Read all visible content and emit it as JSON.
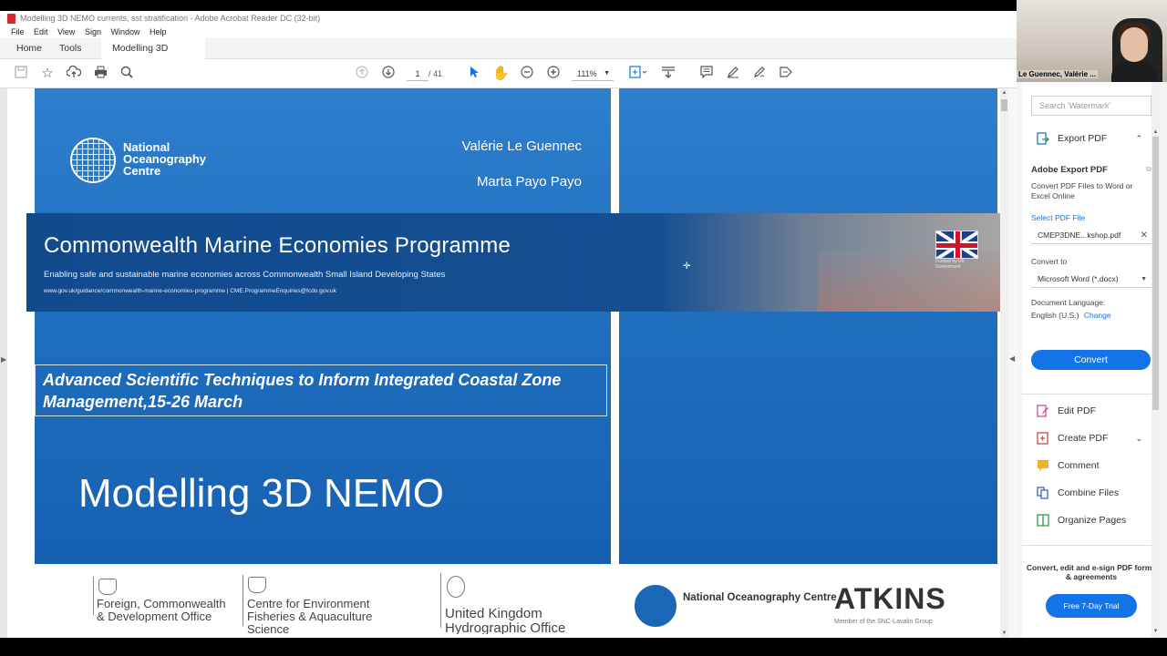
{
  "window": {
    "title": "Modelling 3D NEMO currents, sst stratification - Adobe Acrobat Reader DC (32-bit)"
  },
  "menu": [
    "File",
    "Edit",
    "View",
    "Sign",
    "Window",
    "Help"
  ],
  "tabs": {
    "home": "Home",
    "tools": "Tools",
    "doc": "Modelling 3D NEM...",
    "close": "×"
  },
  "toolbar": {
    "page_current": "1",
    "page_total": "/ 41",
    "zoom": "111%"
  },
  "slide": {
    "org": "National Oceanography Centre",
    "author1": "Valérie Le Guennec",
    "author2": "Marta Payo Payo",
    "banner_title": "Commonwealth Marine Economies Programme",
    "banner_subtitle": "Enabling safe and sustainable marine economies across Commonwealth Small Island Developing States",
    "banner_links": "www.gov.uk/guidance/commonwealth-marine-economies-programme   |   CME.ProgrammeEnquiries@fcdo.gov.uk",
    "funded": "Funded by UK Government",
    "course": "Advanced Scientific Techniques to Inform Integrated Coastal Zone Management,15-26 March",
    "title": "Modelling 3D NEMO"
  },
  "logos": {
    "fcdo": "Foreign, Commonwealth & Development Office",
    "cefas": "Centre for Environment Fisheries & Aquaculture Science",
    "ukho": "United Kingdom Hydrographic Office",
    "noc": "National Oceanography Centre",
    "atkins": "ATKINS",
    "atkins_sub": "Member of the SNC-Lavalin Group"
  },
  "right_pane": {
    "search_placeholder": "Search 'Watermark'",
    "export_pdf": "Export PDF",
    "adobe_export_heading": "Adobe Export PDF",
    "adobe_export_desc": "Convert PDF Files to Word or Excel Online",
    "select_file": "Select PDF File",
    "file_name": "CMEP3DNE...kshop.pdf",
    "convert_to_label": "Convert to",
    "convert_to_value": "Microsoft Word (*.docx)",
    "doc_language_label": "Document Language:",
    "doc_language_value": "English (U.S.)",
    "change": "Change",
    "convert_button": "Convert",
    "tools": [
      "Edit PDF",
      "Create PDF",
      "Comment",
      "Combine Files",
      "Organize Pages"
    ],
    "promo": "Convert, edit and e-sign PDF forms & agreements",
    "trial_button": "Free 7-Day Trial"
  },
  "webcam": {
    "name": "Le Guennec, Valérie ..."
  },
  "colors": {
    "accent": "#1473e6",
    "slide_blue": "#1e6cbc",
    "banner_blue": "#114b8e"
  }
}
